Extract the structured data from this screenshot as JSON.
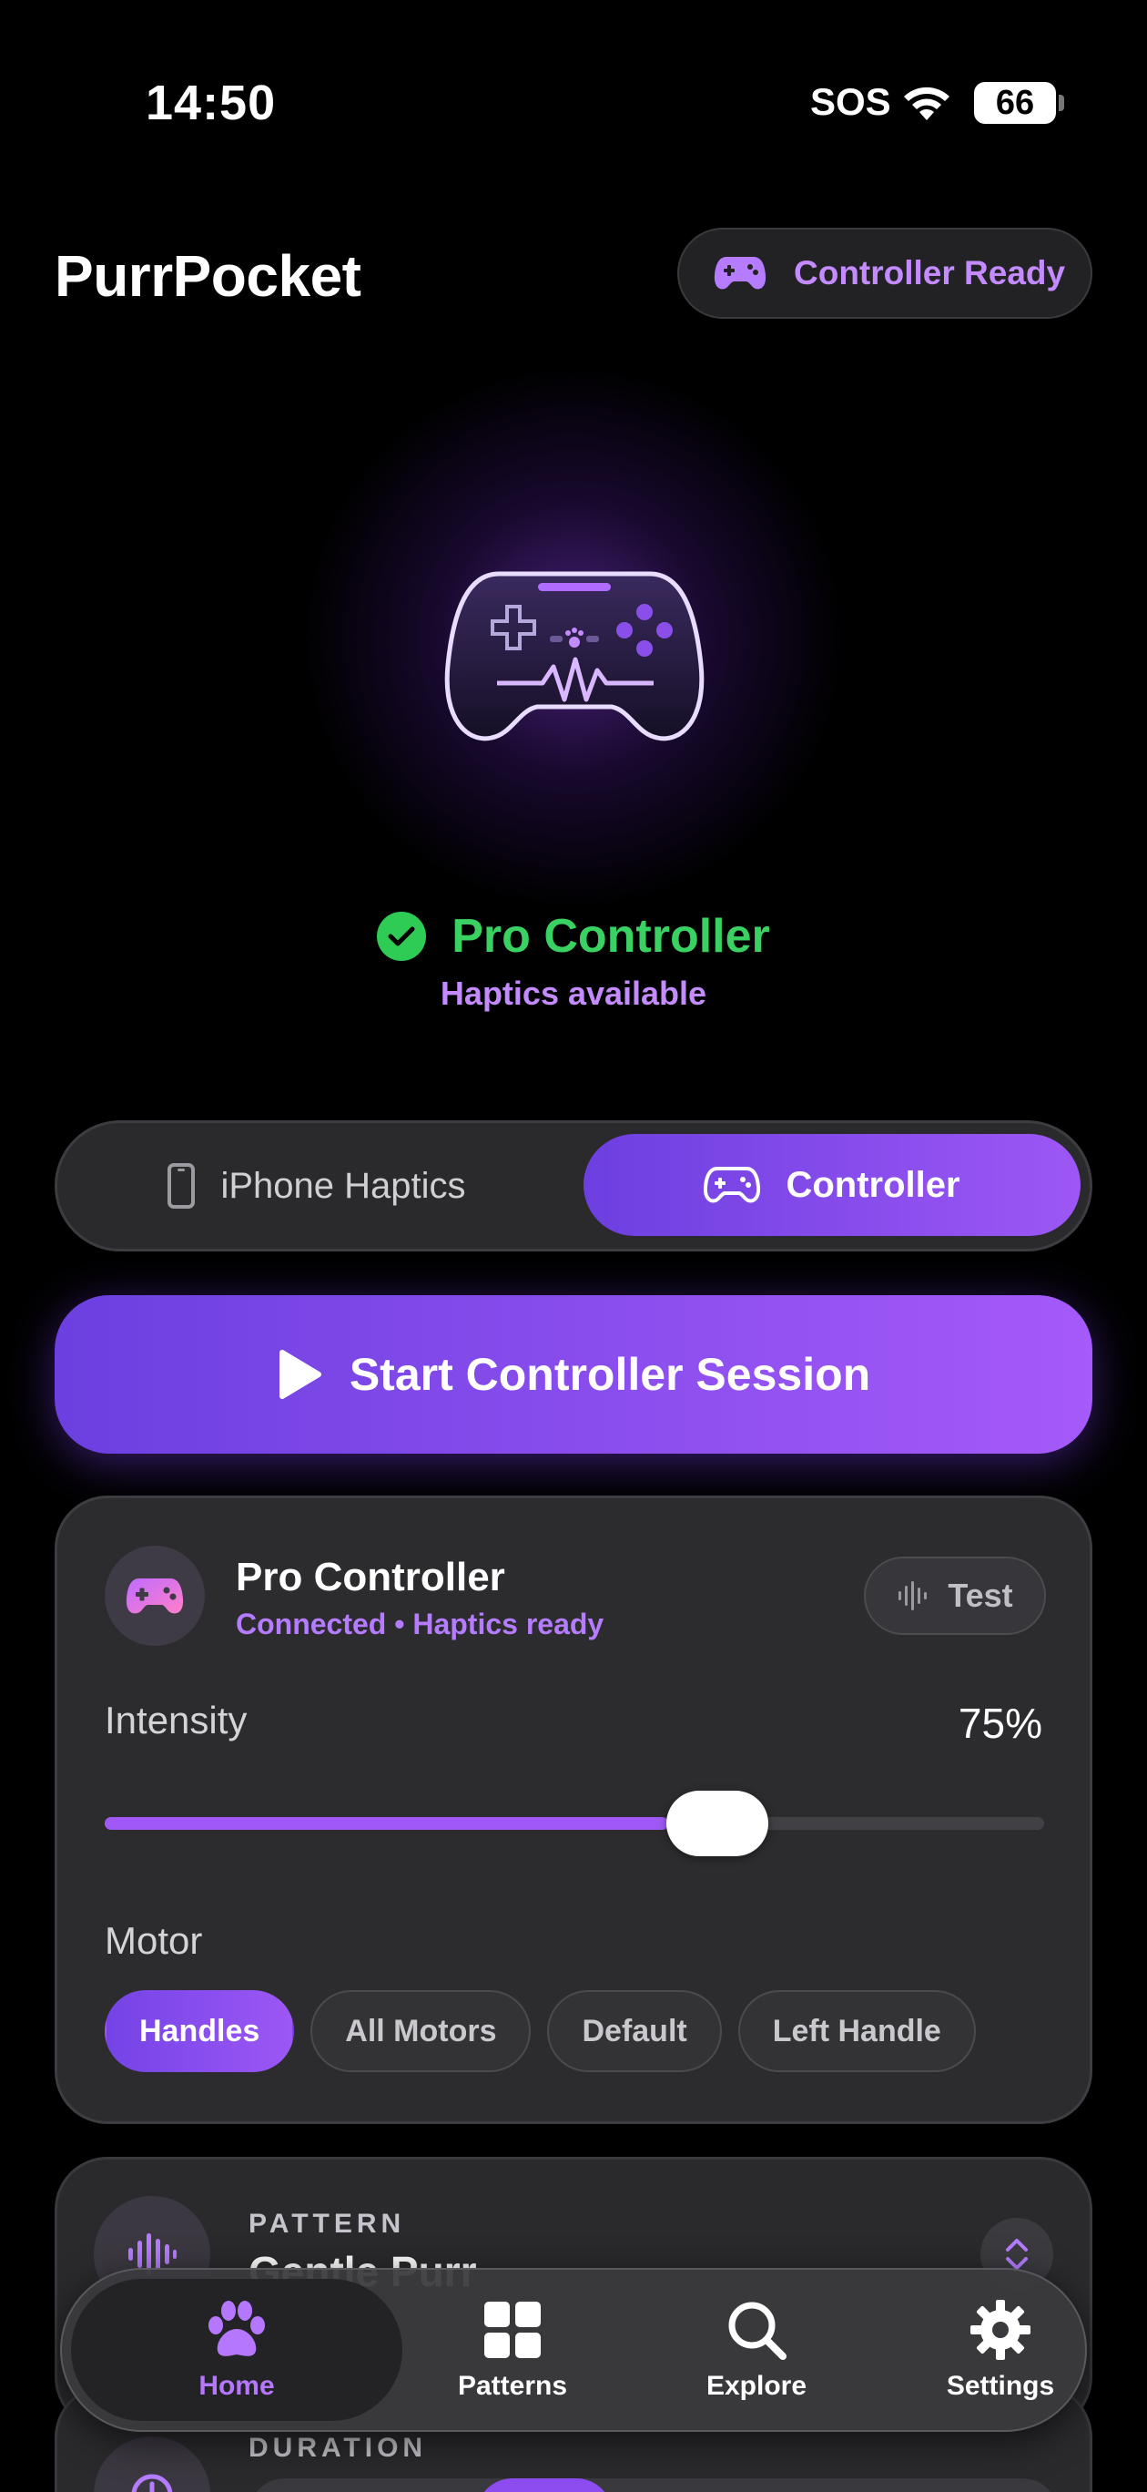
{
  "status_bar": {
    "time": "14:50",
    "sos": "SOS",
    "battery": "66"
  },
  "header": {
    "title": "PurrPocket",
    "status_pill": "Controller Ready",
    "icon": "gamepad-icon"
  },
  "hero": {
    "device_name": "Pro Controller",
    "device_subtitle": "Haptics available",
    "status_icon": "check-icon"
  },
  "mode_switch": {
    "options": [
      {
        "label": "iPhone Haptics",
        "icon": "phone-icon",
        "selected": false
      },
      {
        "label": "Controller",
        "icon": "gamepad-icon",
        "selected": true
      }
    ]
  },
  "start_button": {
    "label": "Start Controller Session",
    "icon": "play-icon"
  },
  "controller_card": {
    "title": "Pro Controller",
    "subtitle": "Connected • Haptics ready",
    "test_label": "Test",
    "intensity_label": "Intensity",
    "intensity_value": "75%",
    "intensity_fraction": 0.6,
    "motor_label": "Motor",
    "motor_options": [
      "Handles",
      "All Motors",
      "Default",
      "Left Handle"
    ],
    "motor_selected": "Handles"
  },
  "pattern_card": {
    "kicker": "PATTERN",
    "value": "Gentle Purr"
  },
  "duration_card": {
    "kicker": "DURATION"
  },
  "tab_bar": {
    "tabs": [
      {
        "label": "Home",
        "icon": "paw-icon",
        "active": true
      },
      {
        "label": "Patterns",
        "icon": "grid-icon",
        "active": false
      },
      {
        "label": "Explore",
        "icon": "search-icon",
        "active": false
      },
      {
        "label": "Settings",
        "icon": "gear-icon",
        "active": false
      }
    ]
  },
  "colors": {
    "accent": "#a059f7",
    "accent_light": "#c48bff",
    "success": "#3ad163",
    "background": "#000000",
    "card": "#2c2c2f"
  }
}
